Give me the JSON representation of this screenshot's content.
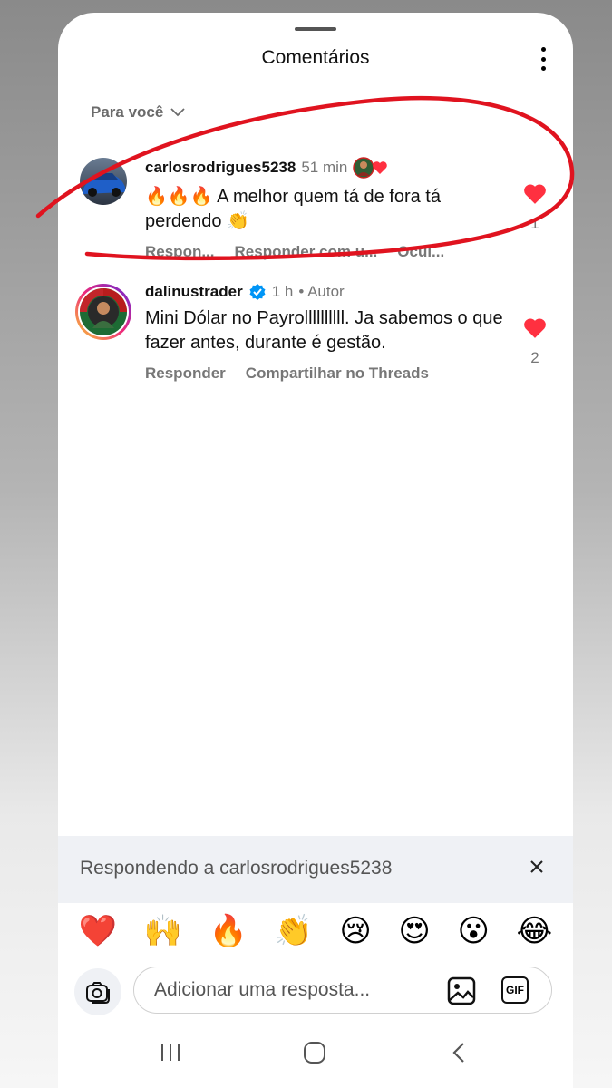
{
  "header": {
    "title": "Comentários"
  },
  "sort": {
    "label": "Para você"
  },
  "comments": [
    {
      "username": "carlosrodrigues5238",
      "time": "51 min",
      "text": "🔥🔥🔥 A melhor quem tá de fora tá perdendo 👏",
      "actions": [
        "Respon...",
        "Responder com u...",
        "Ocul..."
      ],
      "likes": "1"
    },
    {
      "username": "dalinustrader",
      "time": "1 h",
      "author_label": "• Autor",
      "text": "Mini Dólar no Payrollllllllll. Ja sabemos o que fazer antes, durante é gestão.",
      "actions": [
        "Responder",
        "Compartilhar no Threads"
      ],
      "likes": "2"
    }
  ],
  "reply_bar": {
    "text": "Respondendo a carlosrodrigues5238"
  },
  "emojis": [
    "❤️",
    "🙌",
    "🔥",
    "👏",
    "😢",
    "😍",
    "😮",
    "😂"
  ],
  "input": {
    "placeholder": "Adicionar uma resposta..."
  },
  "gif_label": "GIF",
  "colors": {
    "like": "#ff3040",
    "verified": "#0095f6",
    "annotation": "#e0131f"
  }
}
